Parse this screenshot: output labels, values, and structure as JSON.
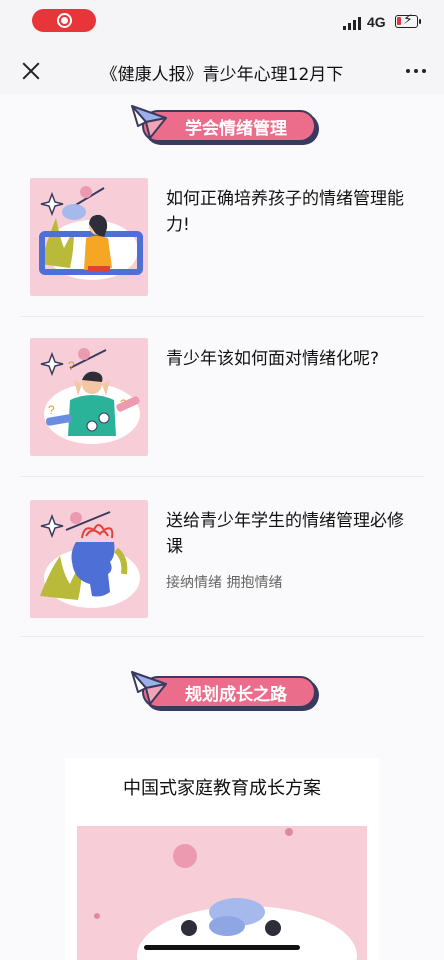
{
  "status_bar": {
    "network": "4G",
    "record_icon": "record-icon",
    "battery_icon": "battery-charging-icon"
  },
  "nav": {
    "title": "《健康人报》青少年心理12月下",
    "close_icon": "close-icon",
    "more_icon": "more-icon"
  },
  "sections": [
    {
      "label": "学会情绪管理",
      "icon": "paper-plane-icon"
    },
    {
      "label": "规划成长之路",
      "icon": "paper-plane-icon"
    }
  ],
  "articles": [
    {
      "title": "如何正确培养孩子的情绪管理能力!",
      "tags": ""
    },
    {
      "title": "青少年该如何面对情绪化呢?",
      "tags": ""
    },
    {
      "title": "送给青少年学生的情绪管理必修课",
      "tags": "接纳情绪 拥抱情绪"
    }
  ],
  "plan": {
    "title": "中国式家庭教育成长方案"
  },
  "colors": {
    "accent_pink": "#ec6d8b",
    "thumb_bg": "#f7cdd7",
    "record_red": "#e8353a"
  }
}
